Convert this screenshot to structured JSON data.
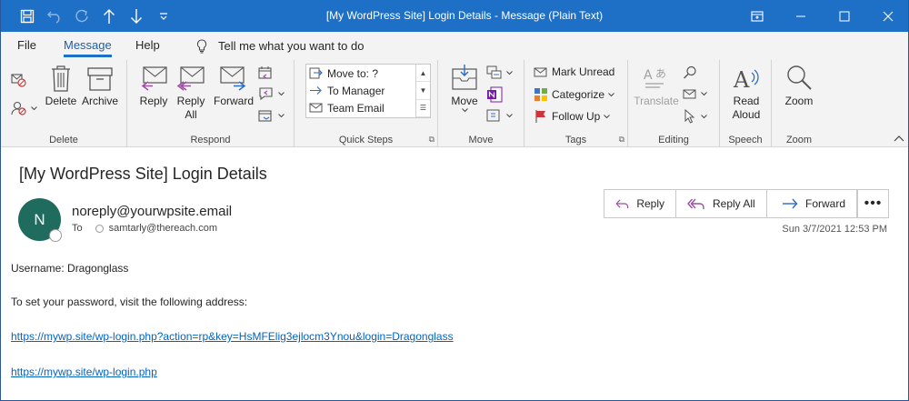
{
  "window": {
    "title": "[My WordPress Site] Login Details  -  Message (Plain Text)"
  },
  "menu": {
    "tabs": [
      {
        "label": "File"
      },
      {
        "label": "Message"
      },
      {
        "label": "Help"
      }
    ],
    "tell_me": "Tell me what you want to do"
  },
  "ribbon": {
    "groups": {
      "delete": {
        "label": "Delete",
        "delete_label": "Delete",
        "archive_label": "Archive"
      },
      "respond": {
        "label": "Respond",
        "reply_label": "Reply",
        "reply_all_line1": "Reply",
        "reply_all_line2": "All",
        "forward_label": "Forward"
      },
      "quick_steps": {
        "label": "Quick Steps",
        "items": [
          {
            "label": "Move to: ?"
          },
          {
            "label": "To Manager"
          },
          {
            "label": "Team Email"
          }
        ]
      },
      "move": {
        "label": "Move",
        "move_label": "Move"
      },
      "tags": {
        "label": "Tags",
        "mark_unread": "Mark Unread",
        "categorize": "Categorize",
        "follow_up": "Follow Up"
      },
      "editing": {
        "label": "Editing",
        "translate": "Translate"
      },
      "speech": {
        "label": "Speech",
        "read_aloud_line1": "Read",
        "read_aloud_line2": "Aloud"
      },
      "zoom": {
        "label": "Zoom",
        "zoom_label": "Zoom"
      }
    }
  },
  "message": {
    "subject": "[My WordPress Site] Login Details",
    "avatar_initial": "N",
    "sender": "noreply@yourwpsite.email",
    "to_label": "To",
    "recipient": "samtarly@thereach.com",
    "timestamp": "Sun 3/7/2021 12:53 PM",
    "actions": {
      "reply": "Reply",
      "reply_all": "Reply All",
      "forward": "Forward",
      "more": "•••"
    },
    "body": {
      "line1": "Username: Dragonglass",
      "line2": "To set your password, visit the following address:",
      "link1": "https://mywp.site/wp-login.php?action=rp&key=HsMFElig3ejlocm3Ynou&login=Dragonglass",
      "link2": "https://mywp.site/wp-login.php"
    }
  },
  "colors": {
    "titlebar": "#1e6fc6",
    "ribbon_bg": "#f3f3f3",
    "avatar": "#1f6b5e",
    "link": "#0563c1",
    "reply_icon": "#9b4fa0",
    "forward_icon": "#2b6cc4"
  }
}
